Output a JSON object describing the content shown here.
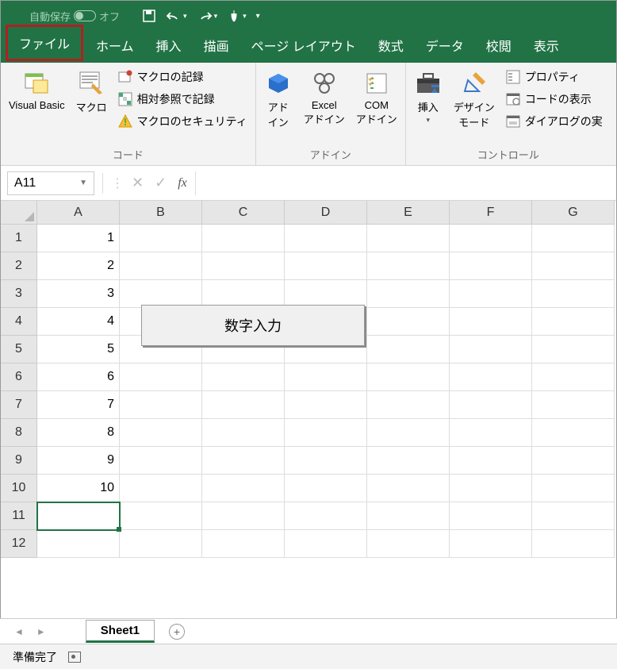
{
  "titlebar": {
    "autosave_label": "自動保存",
    "autosave_state": "オフ"
  },
  "tabs": {
    "file": "ファイル",
    "home": "ホーム",
    "insert": "挿入",
    "draw": "描画",
    "pagelayout": "ページ レイアウト",
    "formulas": "数式",
    "data": "データ",
    "review": "校閲",
    "view": "表示"
  },
  "ribbon": {
    "code": {
      "vb": "Visual Basic",
      "macros": "マクロ",
      "record": "マクロの記録",
      "relative": "相対参照で記録",
      "security": "マクロのセキュリティ",
      "group": "コード"
    },
    "addins": {
      "addin": "アド\nイン",
      "excel": "Excel\nアドイン",
      "com": "COM\nアドイン",
      "group": "アドイン"
    },
    "controls": {
      "insert": "挿入",
      "design": "デザイン\nモード",
      "props": "プロパティ",
      "viewcode": "コードの表示",
      "dialog": "ダイアログの実",
      "group": "コントロール"
    }
  },
  "namebox": "A11",
  "columns": [
    "A",
    "B",
    "C",
    "D",
    "E",
    "F",
    "G"
  ],
  "rows": [
    "1",
    "2",
    "3",
    "4",
    "5",
    "6",
    "7",
    "8",
    "9",
    "10",
    "11",
    "12"
  ],
  "cellsA": [
    "1",
    "2",
    "3",
    "4",
    "5",
    "6",
    "7",
    "8",
    "9",
    "10",
    "",
    ""
  ],
  "selected_row": 11,
  "float_button": "数字入力",
  "sheets": {
    "active": "Sheet1"
  },
  "status": {
    "ready": "準備完了"
  }
}
